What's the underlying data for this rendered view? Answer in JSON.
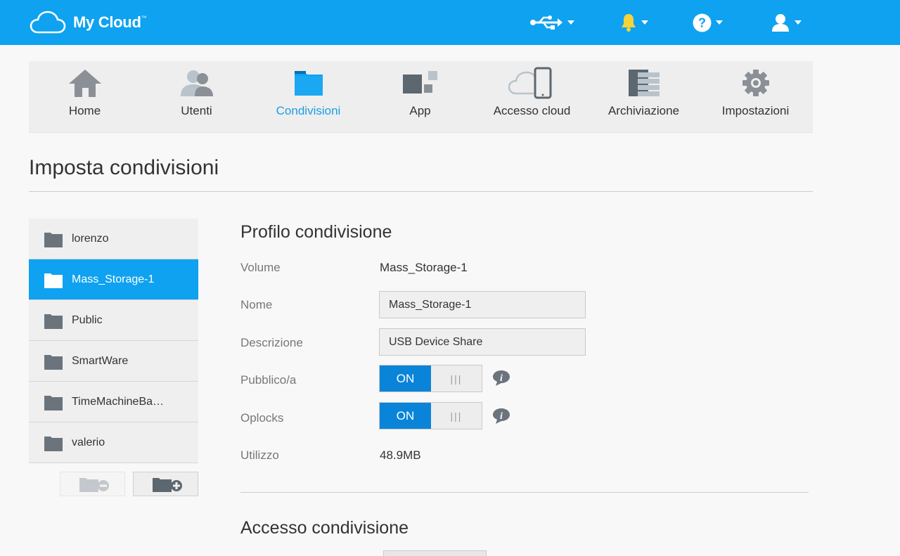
{
  "header": {
    "brand": "My Cloud",
    "brand_tm": "™",
    "icons": [
      "usb-icon",
      "bell-icon",
      "help-icon",
      "user-icon"
    ]
  },
  "nav": {
    "items": [
      {
        "label": "Home",
        "icon": "home-icon"
      },
      {
        "label": "Utenti",
        "icon": "users-icon"
      },
      {
        "label": "Condivisioni",
        "icon": "folder-icon",
        "active": true
      },
      {
        "label": "App",
        "icon": "apps-icon"
      },
      {
        "label": "Accesso cloud",
        "icon": "cloud-device-icon"
      },
      {
        "label": "Archiviazione",
        "icon": "storage-icon"
      },
      {
        "label": "Impostazioni",
        "icon": "gear-icon"
      }
    ]
  },
  "page": {
    "title": "Imposta condivisioni"
  },
  "shares": {
    "items": [
      {
        "name": "lorenzo"
      },
      {
        "name": "Mass_Storage-1",
        "selected": true
      },
      {
        "name": "Public"
      },
      {
        "name": "SmartWare"
      },
      {
        "name": "TimeMachineBa…"
      },
      {
        "name": "valerio"
      }
    ]
  },
  "profile": {
    "title": "Profilo condivisione",
    "volume_label": "Volume",
    "volume_value": "Mass_Storage-1",
    "name_label": "Nome",
    "name_value": "Mass_Storage-1",
    "desc_label": "Descrizione",
    "desc_value": "USB Device Share",
    "public_label": "Pubblico/a",
    "public_state": "ON",
    "oplocks_label": "Oplocks",
    "oplocks_state": "ON",
    "usage_label": "Utilizzo",
    "usage_value": "48.9MB"
  },
  "access": {
    "title": "Accesso condivisione"
  },
  "colors": {
    "accent": "#0ea2f0",
    "active_nav": "#1a9ee6",
    "toggle_on": "#0a84d8",
    "bell": "#f5d33a"
  }
}
